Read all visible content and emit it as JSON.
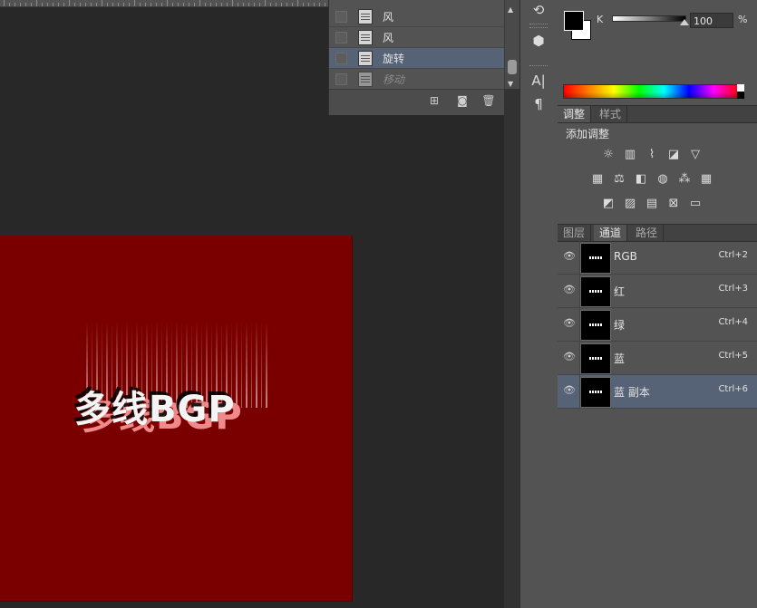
{
  "history": {
    "items": [
      {
        "label": "风",
        "state": "normal"
      },
      {
        "label": "风",
        "state": "normal"
      },
      {
        "label": "旋转",
        "state": "active"
      },
      {
        "label": "移动",
        "state": "disabled"
      }
    ]
  },
  "canvas": {
    "art_text": "多线BGP",
    "background_color": "#7a0000"
  },
  "color_panel": {
    "channel_label": "K",
    "value": "100",
    "unit": "%"
  },
  "adjustments": {
    "tabs": [
      "调整",
      "样式"
    ],
    "title": "添加调整",
    "icons": [
      [
        "brightness-icon",
        "levels-icon",
        "curves-icon",
        "exposure-icon",
        "vibrance-icon"
      ],
      [
        "hue-saturation-icon",
        "color-balance-icon",
        "black-white-icon",
        "photo-filter-icon",
        "channel-mixer-icon",
        "color-lookup-icon"
      ],
      [
        "invert-icon",
        "posterize-icon",
        "threshold-icon",
        "selective-color-icon",
        "gradient-map-icon"
      ]
    ]
  },
  "channels": {
    "tabs": [
      "图层",
      "通道",
      "路径"
    ],
    "rows": [
      {
        "name": "RGB",
        "shortcut": "Ctrl+2",
        "active": false
      },
      {
        "name": "红",
        "shortcut": "Ctrl+3",
        "active": false
      },
      {
        "name": "绿",
        "shortcut": "Ctrl+4",
        "active": false
      },
      {
        "name": "蓝",
        "shortcut": "Ctrl+5",
        "active": false
      },
      {
        "name": "蓝 副本",
        "shortcut": "Ctrl+6",
        "active": true
      }
    ]
  },
  "tools_panel": {
    "items": [
      "history-icon",
      "3d-icon",
      "character-icon",
      "paragraph-icon"
    ]
  }
}
